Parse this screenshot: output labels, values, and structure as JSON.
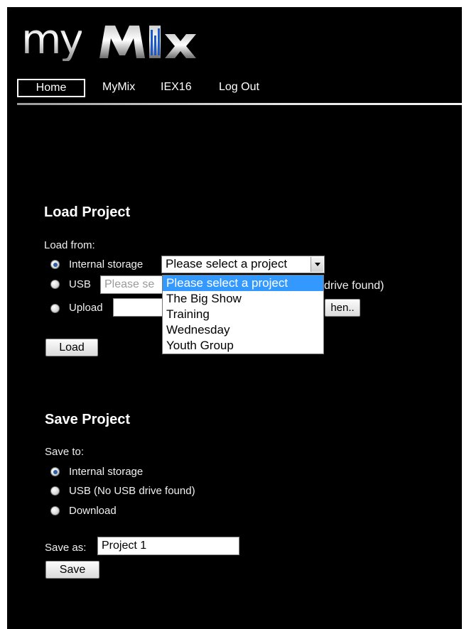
{
  "logo": {
    "text_a": "my",
    "text_b": "Mix"
  },
  "nav": {
    "items": [
      "Home",
      "MyMix",
      "IEX16",
      "Log Out"
    ],
    "active": "Home"
  },
  "load": {
    "heading": "Load Project",
    "from_label": "Load from:",
    "internal_label": "Internal storage",
    "usb_label": "USB",
    "usb_placeholder": "Please se",
    "usb_status": "drive found)",
    "upload_label": "Upload",
    "browse_label": "hen..",
    "load_button": "Load",
    "select_value": "Please select a project",
    "options": [
      "Please select a project",
      "The Big Show",
      "Training",
      "Wednesday",
      "Youth Group"
    ]
  },
  "save": {
    "heading": "Save Project",
    "to_label": "Save to:",
    "internal_label": "Internal storage",
    "usb_label": "USB (No USB drive found)",
    "download_label": "Download",
    "save_as_label": "Save as:",
    "save_as_value": "Project 1",
    "save_button": "Save"
  },
  "colors": {
    "background": "#000000",
    "highlight": "#3399ff",
    "radio_dot": "#2f5fa8"
  }
}
